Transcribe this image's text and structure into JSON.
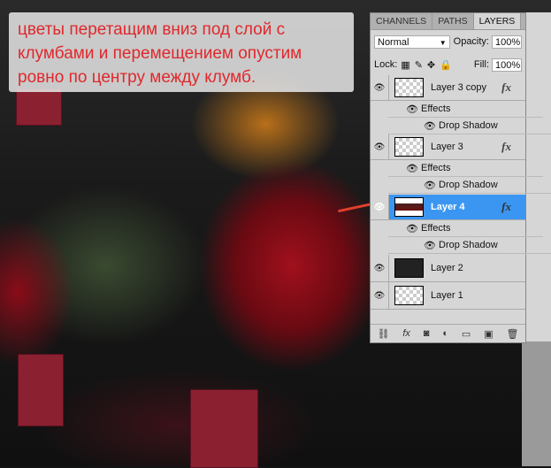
{
  "note": {
    "lines": [
      "цветы перетащим вниз под слой с",
      "клумбами и перемещением опустим",
      "ровно по центру между клумб."
    ]
  },
  "panel": {
    "tabs": [
      {
        "label": "CHANNELS"
      },
      {
        "label": "PATHS"
      },
      {
        "label": "LAYERS",
        "active": true
      }
    ],
    "blend_mode": "Normal",
    "opacity_label": "Opacity:",
    "opacity": "100%",
    "lock_label": "Lock:",
    "fill_label": "Fill:",
    "fill": "100%",
    "layers": [
      {
        "name": "Layer 3 copy",
        "fx": "fx",
        "effects": "Effects",
        "effect": "Drop Shadow"
      },
      {
        "name": "Layer 3",
        "fx": "fx",
        "effects": "Effects",
        "effect": "Drop Shadow"
      },
      {
        "name": "Layer 4",
        "fx": "fx",
        "effects": "Effects",
        "effect": "Drop Shadow",
        "selected": true
      },
      {
        "name": "Layer 2"
      },
      {
        "name": "Layer 1"
      }
    ],
    "bottom_icons": [
      "link-icon",
      "fx-icon",
      "mask-icon",
      "adjustment-icon",
      "folder-icon",
      "new-layer-icon",
      "trash-icon"
    ]
  },
  "colors": {
    "note_text": "#e0282c",
    "selected": "#3b96f2"
  }
}
